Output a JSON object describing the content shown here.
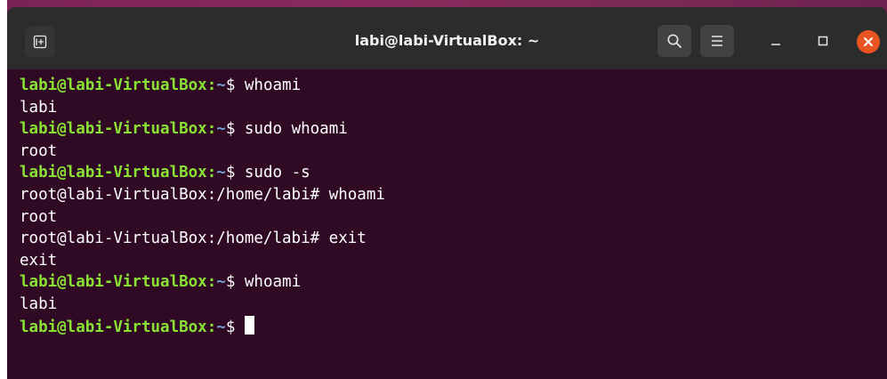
{
  "window": {
    "title": "labi@labi-VirtualBox: ~",
    "buttons": {
      "new_tab_icon": "new-tab-icon",
      "search_icon": "search-icon",
      "menu_icon": "hamburger-menu-icon",
      "minimize_icon": "minimize-icon",
      "maximize_icon": "maximize-icon",
      "close_icon": "close-icon"
    }
  },
  "colors": {
    "terminal_background": "#300a24",
    "titlebar_background": "#2c2c2c",
    "prompt_user_host": "#8ae234",
    "prompt_path": "#729fcf",
    "text": "#ffffff",
    "close_button": "#e95420"
  },
  "terminal": {
    "lines": [
      {
        "user_host": "labi@labi-VirtualBox",
        "sep": ":",
        "path": "~",
        "sym": "$ ",
        "command": "whoami"
      },
      {
        "text": "labi"
      },
      {
        "user_host": "labi@labi-VirtualBox",
        "sep": ":",
        "path": "~",
        "sym": "$ ",
        "command": "sudo whoami"
      },
      {
        "text": "root"
      },
      {
        "user_host": "labi@labi-VirtualBox",
        "sep": ":",
        "path": "~",
        "sym": "$ ",
        "command": "sudo -s"
      },
      {
        "text": "root@labi-VirtualBox:/home/labi# whoami"
      },
      {
        "text": "root"
      },
      {
        "text": "root@labi-VirtualBox:/home/labi# exit"
      },
      {
        "text": "exit"
      },
      {
        "user_host": "labi@labi-VirtualBox",
        "sep": ":",
        "path": "~",
        "sym": "$ ",
        "command": "whoami"
      },
      {
        "text": "labi"
      },
      {
        "user_host": "labi@labi-VirtualBox",
        "sep": ":",
        "path": "~",
        "sym": "$ ",
        "command": ""
      }
    ]
  }
}
